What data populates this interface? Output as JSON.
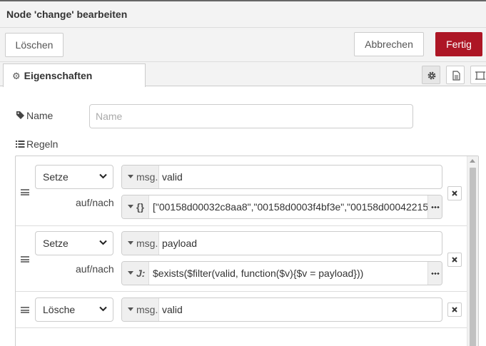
{
  "tray": {
    "title": "Node 'change' bearbeiten"
  },
  "toolbar": {
    "delete_label": "Löschen",
    "cancel_label": "Abbrechen",
    "done_label": "Fertig"
  },
  "tabs": {
    "properties_label": "Eigenschaften"
  },
  "form": {
    "name_label": "Name",
    "name_placeholder": "Name",
    "name_value": "",
    "rules_label": "Regeln"
  },
  "rules": [
    {
      "action": "Setze",
      "target_type": "msg.",
      "target": "valid",
      "to_label": "auf/nach",
      "value_type_icon": "{}",
      "value": "[\"00158d00032c8aa8\",\"00158d0003f4bf3e\",\"00158d00042215"
    },
    {
      "action": "Setze",
      "target_type": "msg.",
      "target": "payload",
      "to_label": "auf/nach",
      "value_type_icon": "J:",
      "value": "$exists($filter(valid, function($v){$v = payload}))"
    },
    {
      "action": "Lösche",
      "target_type": "msg.",
      "target": "valid"
    }
  ],
  "colors": {
    "primary": "#ad1625",
    "border": "#cccccc",
    "header_bg": "#f3f3f3"
  }
}
